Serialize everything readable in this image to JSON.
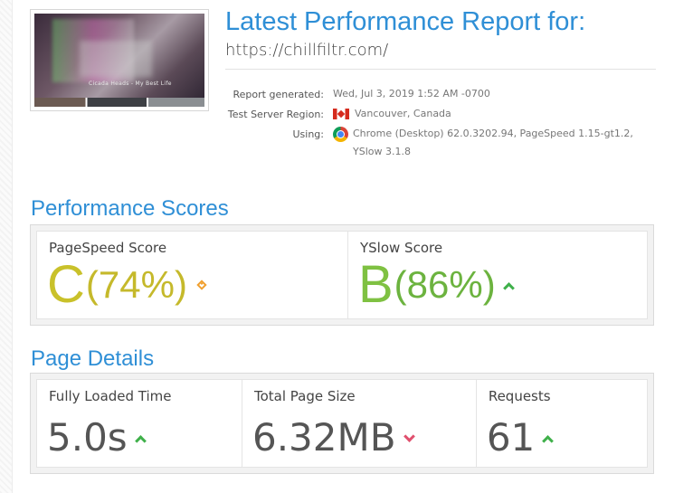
{
  "header": {
    "title": "Latest Performance Report for:",
    "url": "https://chillfiltr.com/",
    "thumbnail_caption": "Cicada Heads - My Best Life"
  },
  "meta": {
    "report_generated_label": "Report generated:",
    "report_generated_value": "Wed, Jul 3, 2019 1:52 AM -0700",
    "server_region_label": "Test Server Region:",
    "server_region_value": "Vancouver, Canada",
    "server_region_icon": "canada-flag-icon",
    "using_label": "Using:",
    "using_value": "Chrome (Desktop) 62.0.3202.94, PageSpeed 1.15-gt1.2, YSlow 3.1.8",
    "using_icon": "chrome-icon"
  },
  "performance": {
    "title": "Performance Scores",
    "pagespeed": {
      "label": "PageSpeed Score",
      "grade": "C",
      "percent": "(74%)",
      "trend_icon": "diamond-icon",
      "color": "#c9c12a"
    },
    "yslow": {
      "label": "YSlow Score",
      "grade": "B",
      "percent": "(86%)",
      "trend_icon": "up-arrow-icon",
      "color": "#7fc142"
    }
  },
  "details": {
    "title": "Page Details",
    "load_time": {
      "label": "Fully Loaded Time",
      "value": "5.0s",
      "trend_icon": "up-arrow-icon"
    },
    "page_size": {
      "label": "Total Page Size",
      "value": "6.32MB",
      "trend_icon": "down-arrow-icon"
    },
    "requests": {
      "label": "Requests",
      "value": "61",
      "trend_icon": "up-arrow-icon"
    }
  },
  "colors": {
    "accent": "#2f8fd6",
    "up": "#3fb04a",
    "down": "#e0506e",
    "neutral": "#f0a030"
  }
}
